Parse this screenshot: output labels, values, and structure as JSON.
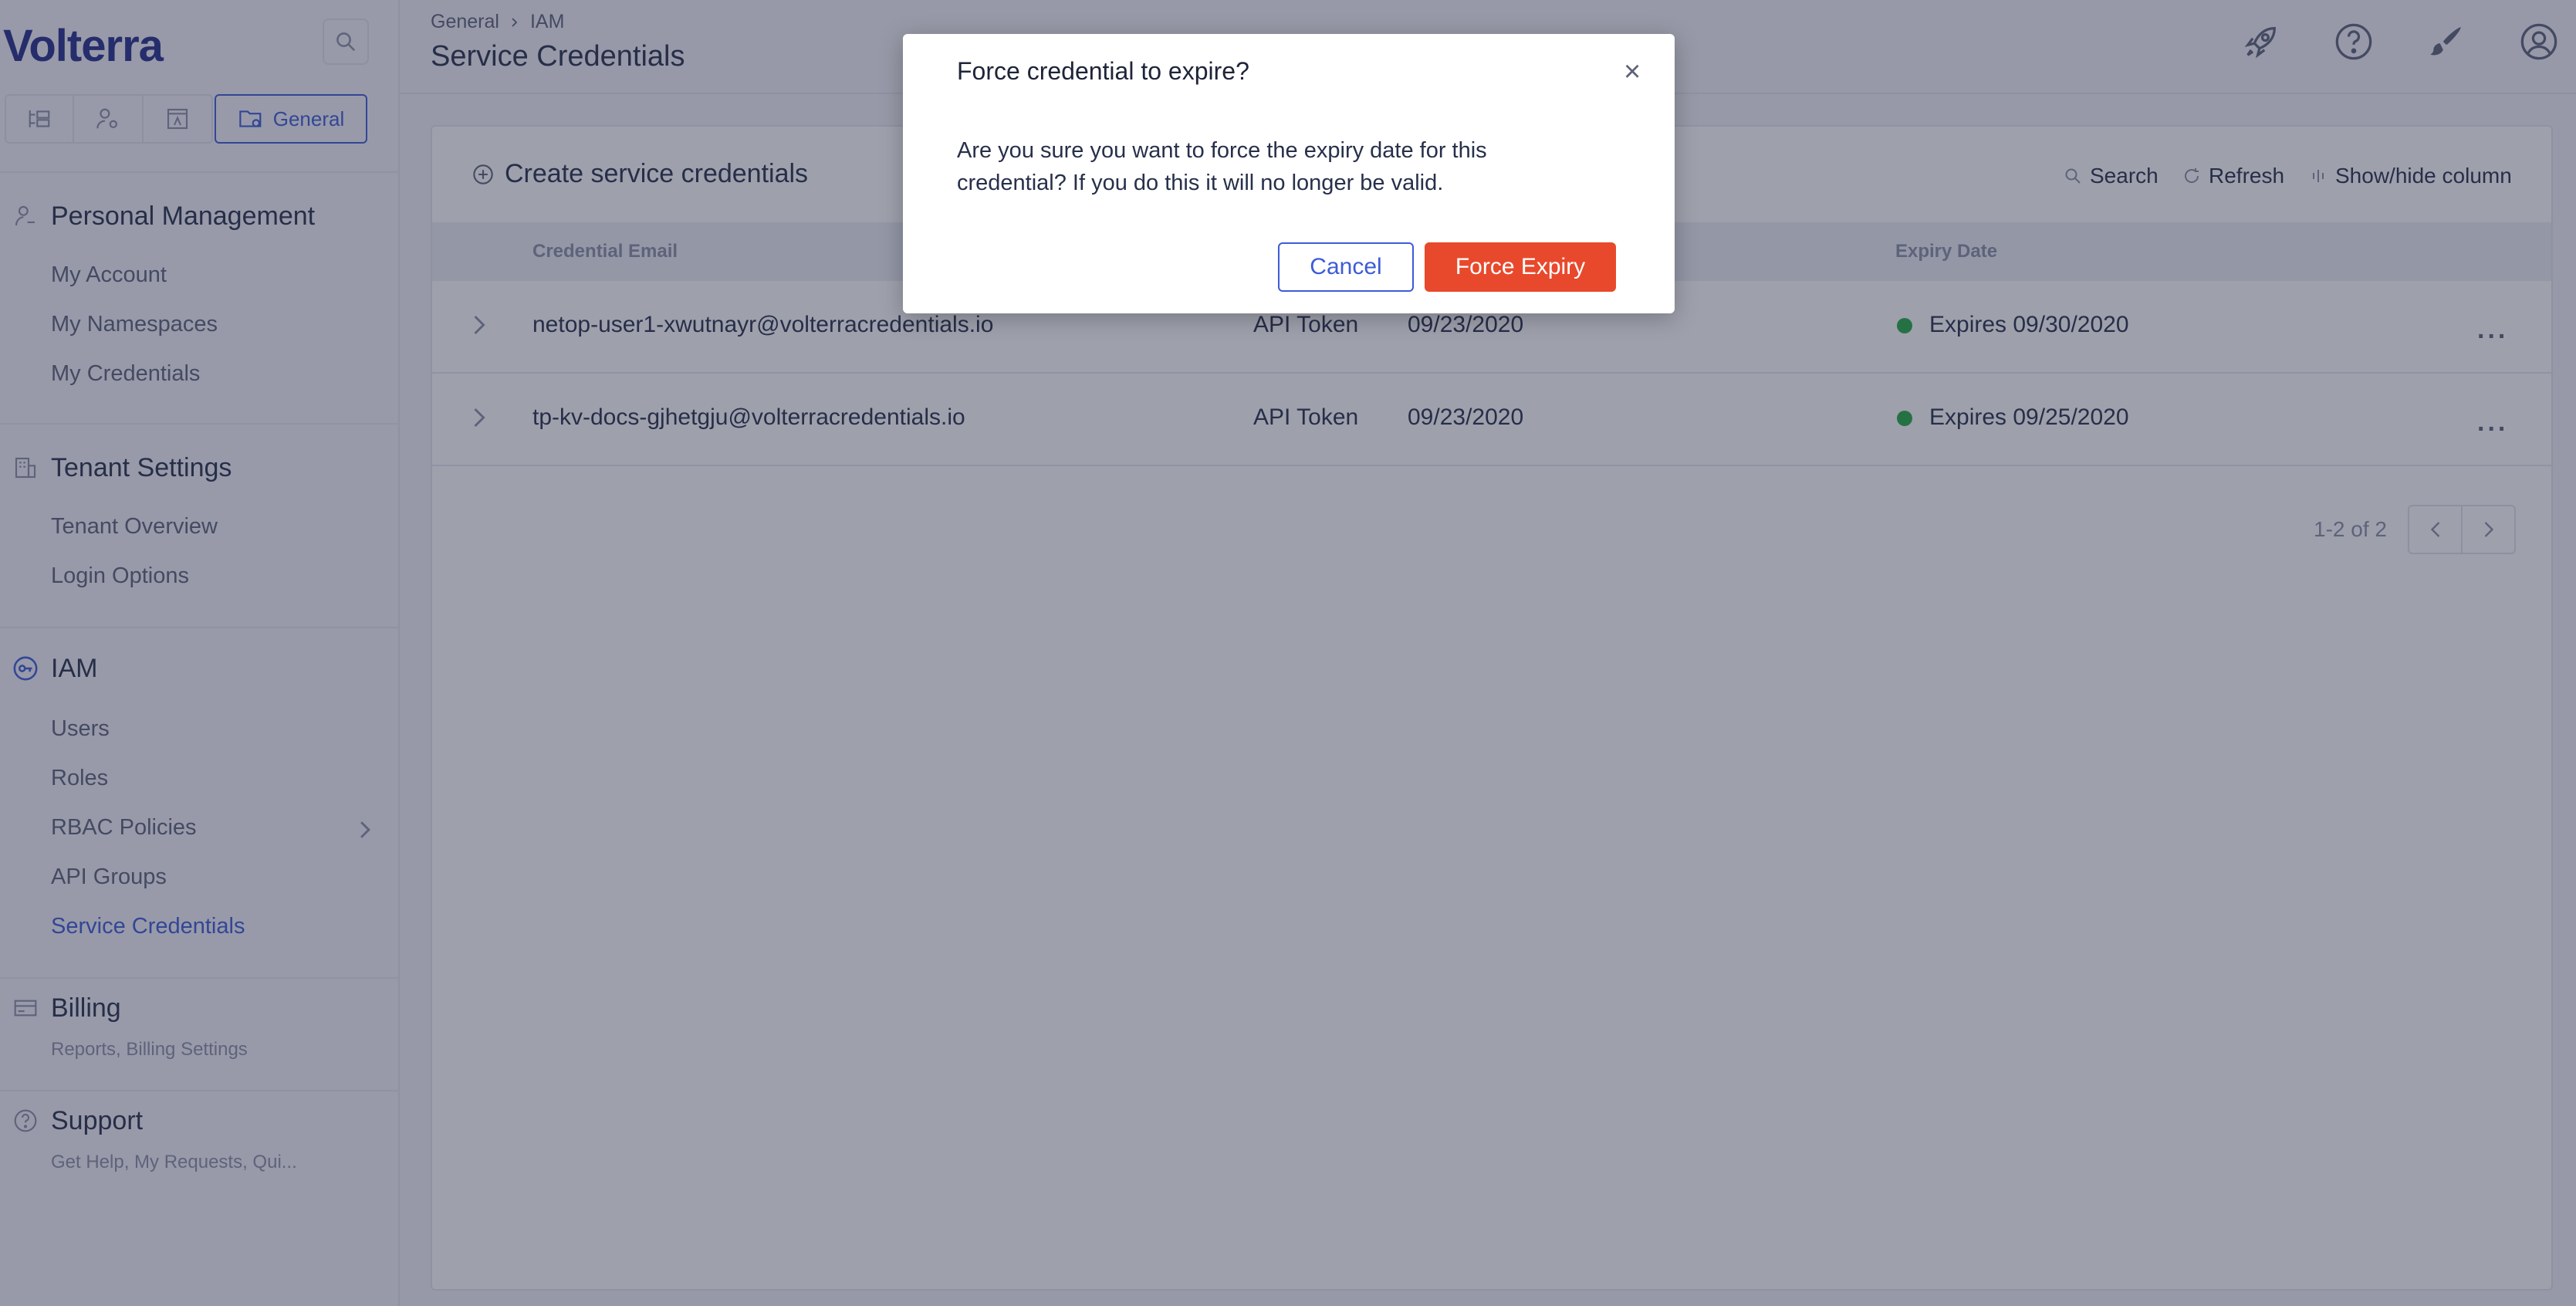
{
  "brand": {
    "logo_text": "Volterra"
  },
  "sidebar": {
    "workspace_label": "General",
    "sections": {
      "personal": {
        "title": "Personal Management",
        "items": [
          "My Account",
          "My Namespaces",
          "My Credentials"
        ]
      },
      "tenant": {
        "title": "Tenant Settings",
        "items": [
          "Tenant Overview",
          "Login Options"
        ]
      },
      "iam": {
        "title": "IAM",
        "items": [
          "Users",
          "Roles",
          "RBAC Policies",
          "API Groups",
          "Service Credentials"
        ],
        "active_item": "Service Credentials"
      },
      "billing": {
        "title": "Billing",
        "subtitle": "Reports, Billing Settings"
      },
      "support": {
        "title": "Support",
        "subtitle": "Get Help, My Requests, Qui..."
      }
    }
  },
  "header": {
    "breadcrumb": [
      "General",
      "IAM"
    ],
    "title": "Service Credentials"
  },
  "toolbar": {
    "create_label": "Create service credentials",
    "search_label": "Search",
    "refresh_label": "Refresh",
    "columns_label": "Show/hide column"
  },
  "table": {
    "columns": {
      "email": "Credential Email",
      "expiry": "Expiry Date"
    },
    "rows": [
      {
        "email": "netop-user1-xwutnayr@volterracredentials.io",
        "type": "API Token",
        "created": "09/23/2020",
        "expiry": "Expires 09/30/2020",
        "status_color": "#26a942"
      },
      {
        "email": "tp-kv-docs-gjhetgju@volterracredentials.io",
        "type": "API Token",
        "created": "09/23/2020",
        "expiry": "Expires 09/25/2020",
        "status_color": "#26a942"
      }
    ],
    "more_label": "...",
    "pagination": "1-2 of 2"
  },
  "modal": {
    "title": "Force credential to expire?",
    "close": "×",
    "body": "Are you sure you want to force the expiry date for this credential? If you do this it will no longer be valid.",
    "cancel_label": "Cancel",
    "confirm_label": "Force Expiry"
  },
  "colors": {
    "accent": "#3d5bd8",
    "danger": "#e8492c",
    "status_ok": "#26a942"
  }
}
